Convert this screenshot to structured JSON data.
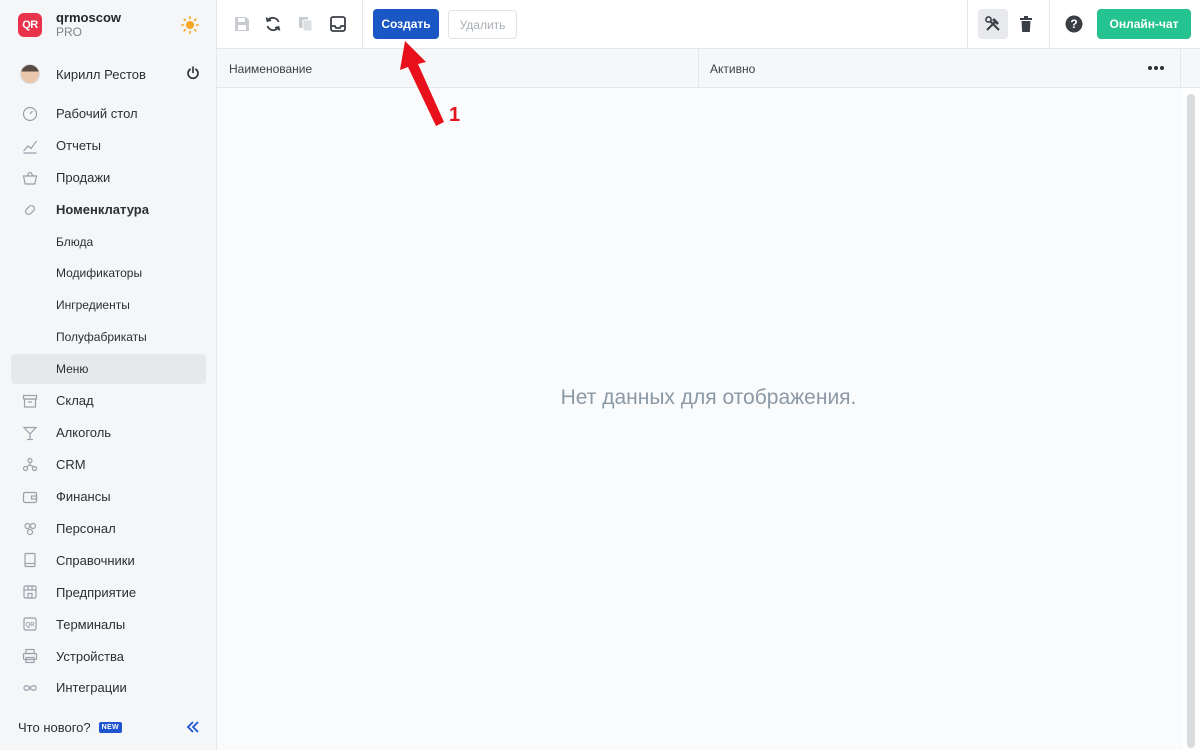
{
  "brand": {
    "logo": "QR",
    "name": "qrmoscow",
    "plan": "PRO",
    "theme_icon": "sun-icon"
  },
  "user": {
    "name": "Кирилл Рестов",
    "power_icon": "power-icon"
  },
  "nav": {
    "items": [
      {
        "label": "Рабочий стол",
        "icon": "dashboard-icon"
      },
      {
        "label": "Отчеты",
        "icon": "reports-icon"
      },
      {
        "label": "Продажи",
        "icon": "basket-icon"
      },
      {
        "label": "Номенклатура",
        "icon": "tag-icon"
      }
    ],
    "sub_items": [
      {
        "label": "Блюда"
      },
      {
        "label": "Модификаторы"
      },
      {
        "label": "Ингредиенты"
      },
      {
        "label": "Полуфабрикаты"
      },
      {
        "label": "Меню",
        "active": true
      }
    ],
    "items_after": [
      {
        "label": "Склад",
        "icon": "warehouse-icon"
      },
      {
        "label": "Алкоголь",
        "icon": "cocktail-icon"
      },
      {
        "label": "CRM",
        "icon": "crm-icon"
      },
      {
        "label": "Финансы",
        "icon": "wallet-icon"
      },
      {
        "label": "Персонал",
        "icon": "staff-icon"
      },
      {
        "label": "Справочники",
        "icon": "book-icon"
      },
      {
        "label": "Предприятие",
        "icon": "store-icon"
      },
      {
        "label": "Терминалы",
        "icon": "qr-terminal-icon"
      },
      {
        "label": "Устройства",
        "icon": "printer-icon"
      },
      {
        "label": "Интеграции",
        "icon": "infinity-icon"
      }
    ]
  },
  "footer": {
    "whats_new": "Что нового?",
    "badge": "NEW"
  },
  "toolbar": {
    "create_label": "Создать",
    "delete_label": "Удалить",
    "chat_label": "Онлайн-чат"
  },
  "table": {
    "columns": [
      "Наименование",
      "Активно"
    ],
    "empty_text": "Нет данных для отображения."
  },
  "annotation": {
    "label": "1",
    "color": "#e8101a"
  },
  "colors": {
    "primary": "#1a56c4",
    "chat": "#25c38f",
    "accent_red": "#e8334a"
  }
}
